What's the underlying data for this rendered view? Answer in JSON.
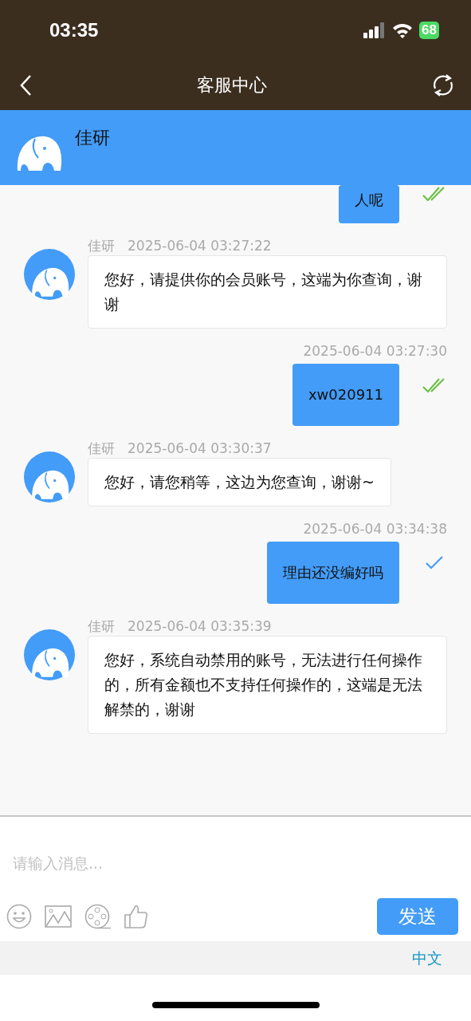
{
  "status_bar": {
    "time": "03:35",
    "battery": "68"
  },
  "nav": {
    "title": "客服中心"
  },
  "agent": {
    "name": "佳研"
  },
  "messages": [
    {
      "kind": "self",
      "text": "人呢",
      "read": true
    },
    {
      "kind": "agent",
      "name": "佳研",
      "time": "2025-06-04 03:27:22",
      "text": "您好，请提供你的会员账号，这端为你查询，谢谢"
    },
    {
      "kind": "self",
      "time": "2025-06-04 03:27:30",
      "text": "xw020911",
      "read": true
    },
    {
      "kind": "agent",
      "name": "佳研",
      "time": "2025-06-04 03:30:37",
      "text": "您好，请您稍等，这边为您查询，谢谢~"
    },
    {
      "kind": "self",
      "time": "2025-06-04 03:34:38",
      "text": "理由还没编好吗",
      "read": false
    },
    {
      "kind": "agent",
      "name": "佳研",
      "time": "2025-06-04 03:35:39",
      "text": "您好，系统自动禁用的账号，无法进行任何操作的，所有金额也不支持任何操作的，这端是无法解禁的，谢谢"
    }
  ],
  "composer": {
    "placeholder": "请输入消息...",
    "send": "发送"
  },
  "language": "中文"
}
